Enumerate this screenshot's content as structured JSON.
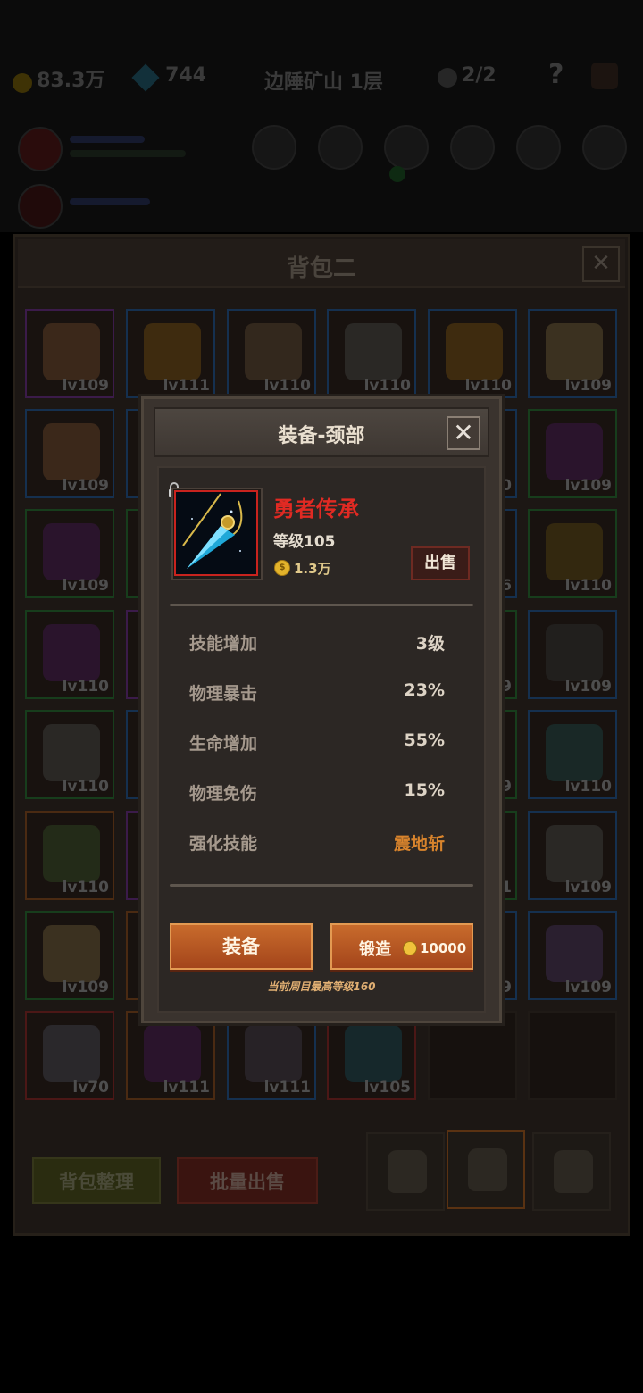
{
  "hud": {
    "gold": "83.3万",
    "gems": "744",
    "location": "边陲矿山 1层",
    "counter": "2/2",
    "help": "?"
  },
  "bag": {
    "title": "背包二",
    "close": "✕",
    "rows": [
      [
        {
          "lv": "lv109",
          "rarity": "purple",
          "art": "#5a3b24"
        },
        {
          "lv": "lv111",
          "rarity": "blue",
          "art": "#5e3f10"
        },
        {
          "lv": "lv110",
          "rarity": "blue",
          "art": "#4a3a2a"
        },
        {
          "lv": "lv110",
          "rarity": "blue",
          "art": "#3a3a38"
        },
        {
          "lv": "lv110",
          "rarity": "blue",
          "art": "#5e3f10"
        },
        {
          "lv": "lv109",
          "rarity": "blue",
          "art": "#5a4a30"
        }
      ],
      [
        {
          "lv": "lv109",
          "rarity": "blue",
          "art": "#5a3b24"
        },
        {
          "lv": "",
          "rarity": "blue",
          "art": "#2a2a2a"
        },
        {
          "lv": "",
          "rarity": "blue",
          "art": "#2a2a2a"
        },
        {
          "lv": "",
          "rarity": "blue",
          "art": "#2a2a2a"
        },
        {
          "lv": "0",
          "rarity": "blue",
          "art": "#2a2a2a"
        },
        {
          "lv": "lv109",
          "rarity": "green",
          "art": "#3a1646"
        }
      ],
      [
        {
          "lv": "lv109",
          "rarity": "green",
          "art": "#3a1646"
        },
        {
          "lv": "",
          "rarity": "green",
          "art": "#2a2a2a"
        },
        {
          "lv": "",
          "rarity": "green",
          "art": "#2a2a2a"
        },
        {
          "lv": "",
          "rarity": "green",
          "art": "#2a2a2a"
        },
        {
          "lv": "6",
          "rarity": "blue",
          "art": "#2a2040"
        },
        {
          "lv": "lv110",
          "rarity": "green",
          "art": "#4a3a10"
        }
      ],
      [
        {
          "lv": "lv110",
          "rarity": "green",
          "art": "#3a1646"
        },
        {
          "lv": "",
          "rarity": "purple",
          "art": "#2a2a2a"
        },
        {
          "lv": "",
          "rarity": "green",
          "art": "#2a2a2a"
        },
        {
          "lv": "",
          "rarity": "green",
          "art": "#2a2a2a"
        },
        {
          "lv": "9",
          "rarity": "green",
          "art": "#2a2a2a"
        },
        {
          "lv": "lv109",
          "rarity": "blue",
          "art": "#2a2a2a"
        }
      ],
      [
        {
          "lv": "lv110",
          "rarity": "green",
          "art": "#3a3a38"
        },
        {
          "lv": "",
          "rarity": "blue",
          "art": "#2a2a2a"
        },
        {
          "lv": "",
          "rarity": "blue",
          "art": "#2a2a2a"
        },
        {
          "lv": "",
          "rarity": "blue",
          "art": "#2a2a2a"
        },
        {
          "lv": "9",
          "rarity": "green",
          "art": "#2a2a2a"
        },
        {
          "lv": "lv110",
          "rarity": "blue",
          "art": "#1c3a3a"
        }
      ],
      [
        {
          "lv": "lv110",
          "rarity": "orange",
          "art": "#2e4020"
        },
        {
          "lv": "",
          "rarity": "purple",
          "art": "#2a2a2a"
        },
        {
          "lv": "",
          "rarity": "blue",
          "art": "#2a2a2a"
        },
        {
          "lv": "",
          "rarity": "blue",
          "art": "#2a2a2a"
        },
        {
          "lv": "1",
          "rarity": "green",
          "art": "#2a2a2a"
        },
        {
          "lv": "lv109",
          "rarity": "blue",
          "art": "#3a3a38"
        }
      ],
      [
        {
          "lv": "lv109",
          "rarity": "green",
          "art": "#5a4a30"
        },
        {
          "lv": "",
          "rarity": "orange",
          "art": "#2a2a2a"
        },
        {
          "lv": "",
          "rarity": "blue",
          "art": "#2a2a2a"
        },
        {
          "lv": "",
          "rarity": "blue",
          "art": "#2a2a2a"
        },
        {
          "lv": "9",
          "rarity": "blue",
          "art": "#2a2a2a"
        },
        {
          "lv": "lv109",
          "rarity": "blue",
          "art": "#3a2a4a"
        }
      ],
      [
        {
          "lv": "lv70",
          "rarity": "red",
          "art": "#3a3a44"
        },
        {
          "lv": "lv111",
          "rarity": "orange",
          "art": "#3a1646"
        },
        {
          "lv": "lv111",
          "rarity": "blue",
          "art": "#34303a"
        },
        {
          "lv": "lv105",
          "rarity": "red",
          "art": "#163a44"
        },
        {
          "lv": "",
          "rarity": "empty",
          "art": ""
        },
        {
          "lv": "",
          "rarity": "empty",
          "art": ""
        }
      ]
    ],
    "sort_button": "背包整理",
    "bulk_sell_button": "批量出售"
  },
  "dialog": {
    "title": "装备-颈部",
    "close": "✕",
    "item": {
      "name": "勇者传承",
      "level_label": "等级105",
      "price": "1.3万",
      "coin_symbol": "$",
      "sell_button": "出售"
    },
    "stats": [
      {
        "label": "技能增加",
        "value": "3级"
      },
      {
        "label": "物理暴击",
        "value": "23%"
      },
      {
        "label": "生命增加",
        "value": "55%"
      },
      {
        "label": "物理免伤",
        "value": "15%"
      },
      {
        "label": "强化技能",
        "value": "震地斩"
      }
    ],
    "equip_button": "装备",
    "forge_button": "锻造",
    "forge_cost": "10000",
    "note": "当前周目最高等级160"
  },
  "colors": {
    "item_name": "#e12a23",
    "skill_text": "#d9842c",
    "button_orange": "#b8582a"
  }
}
